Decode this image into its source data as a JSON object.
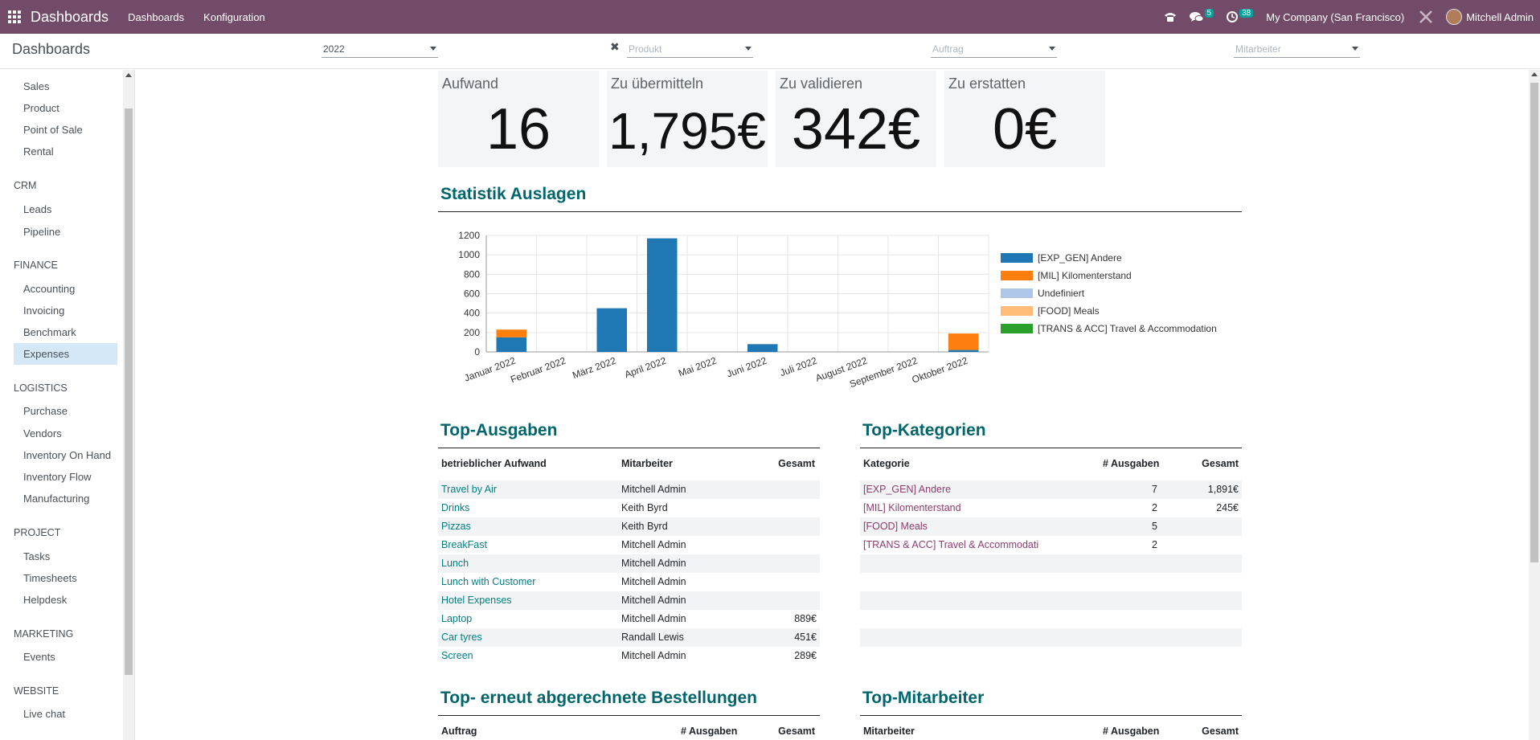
{
  "navbar": {
    "brand": "Dashboards",
    "menu": [
      "Dashboards",
      "Konfiguration"
    ],
    "messages_count": "5",
    "activities_count": "38",
    "company": "My Company (San Francisco)",
    "user": "Mitchell Admin"
  },
  "control": {
    "title": "Dashboards",
    "filters": [
      {
        "value": "2022",
        "placeholder": ""
      },
      {
        "value": "",
        "placeholder": "Produkt"
      },
      {
        "value": "",
        "placeholder": "Auftrag"
      },
      {
        "value": "",
        "placeholder": "Mitarbeiter"
      }
    ],
    "clear_icon": "✖"
  },
  "sidebar": {
    "sections": [
      {
        "header": "",
        "items": [
          "Sales",
          "Product",
          "Point of Sale",
          "Rental"
        ]
      },
      {
        "header": "CRM",
        "items": [
          "Leads",
          "Pipeline"
        ]
      },
      {
        "header": "FINANCE",
        "items": [
          "Accounting",
          "Invoicing",
          "Benchmark",
          "Expenses"
        ]
      },
      {
        "header": "LOGISTICS",
        "items": [
          "Purchase",
          "Vendors",
          "Inventory On Hand",
          "Inventory Flow",
          "Manufacturing"
        ]
      },
      {
        "header": "PROJECT",
        "items": [
          "Tasks",
          "Timesheets",
          "Helpdesk"
        ]
      },
      {
        "header": "MARKETING",
        "items": [
          "Events"
        ]
      },
      {
        "header": "WEBSITE",
        "items": [
          "Live chat"
        ]
      }
    ],
    "active": "Expenses"
  },
  "kpis": [
    {
      "label": "Aufwand",
      "value": "16"
    },
    {
      "label": "Zu übermitteln",
      "value": "1,795€"
    },
    {
      "label": "Zu validieren",
      "value": "342€"
    },
    {
      "label": "Zu erstatten",
      "value": "0€"
    }
  ],
  "sections": {
    "stats": "Statistik Auslagen",
    "top_expenses": "Top-Ausgaben",
    "top_categories": "Top-Kategorien",
    "top_reinvoiced": "Top- erneut abgerechnete Bestellungen",
    "top_employees": "Top-Mitarbeiter"
  },
  "chart_data": {
    "type": "bar",
    "stacked": true,
    "categories": [
      "Januar 2022",
      "Februar 2022",
      "März 2022",
      "April 2022",
      "Mai 2022",
      "Juni 2022",
      "Juli 2022",
      "August 2022",
      "September 2022",
      "Oktober 2022"
    ],
    "series": [
      {
        "name": "[EXP_GEN] Andere",
        "color": "#1f77b4",
        "values": [
          150,
          0,
          450,
          1170,
          0,
          80,
          0,
          0,
          0,
          20
        ]
      },
      {
        "name": "[MIL] Kilomenterstand",
        "color": "#ff7f0e",
        "values": [
          80,
          0,
          0,
          0,
          0,
          0,
          0,
          0,
          0,
          170
        ]
      },
      {
        "name": "Undefiniert",
        "color": "#aec7e8",
        "values": [
          0,
          0,
          0,
          0,
          0,
          0,
          0,
          0,
          0,
          0
        ]
      },
      {
        "name": "[FOOD] Meals",
        "color": "#ffbb78",
        "values": [
          0,
          0,
          0,
          0,
          0,
          0,
          0,
          0,
          0,
          0
        ]
      },
      {
        "name": "[TRANS & ACC] Travel & Accommodation",
        "color": "#2ca02c",
        "values": [
          0,
          0,
          0,
          0,
          0,
          0,
          0,
          0,
          0,
          0
        ]
      }
    ],
    "ylim": [
      0,
      1200
    ],
    "yticks": [
      0,
      200,
      400,
      600,
      800,
      1000,
      1200
    ],
    "grid": true,
    "legend_position": "right"
  },
  "top_expenses": {
    "headers": [
      "betrieblicher Aufwand",
      "Mitarbeiter",
      "Gesamt"
    ],
    "rows": [
      [
        "Travel by Air",
        "Mitchell Admin",
        ""
      ],
      [
        "Drinks",
        "Keith Byrd",
        ""
      ],
      [
        "Pizzas",
        "Keith Byrd",
        ""
      ],
      [
        "BreakFast",
        "Mitchell Admin",
        ""
      ],
      [
        "Lunch",
        "Mitchell Admin",
        ""
      ],
      [
        "Lunch with Customer",
        "Mitchell Admin",
        ""
      ],
      [
        "Hotel Expenses",
        "Mitchell Admin",
        ""
      ],
      [
        "Laptop",
        "Mitchell Admin",
        "889€"
      ],
      [
        "Car tyres",
        "Randall Lewis",
        "451€"
      ],
      [
        "Screen",
        "Mitchell Admin",
        "289€"
      ]
    ]
  },
  "top_categories": {
    "headers": [
      "Kategorie",
      "# Ausgaben",
      "Gesamt"
    ],
    "rows": [
      [
        "[EXP_GEN] Andere",
        "7",
        "1,891€"
      ],
      [
        "[MIL] Kilomenterstand",
        "2",
        "245€"
      ],
      [
        "[FOOD] Meals",
        "5",
        ""
      ],
      [
        "[TRANS & ACC] Travel & Accommodati",
        "2",
        ""
      ],
      [
        "",
        "",
        ""
      ],
      [
        "",
        "",
        ""
      ],
      [
        "",
        "",
        ""
      ],
      [
        "",
        "",
        ""
      ],
      [
        "",
        "",
        ""
      ],
      [
        "",
        "",
        ""
      ]
    ]
  },
  "top_reinvoiced": {
    "headers": [
      "Auftrag",
      "# Ausgaben",
      "Gesamt"
    ]
  },
  "top_employees": {
    "headers": [
      "Mitarbeiter",
      "# Ausgaben",
      "Gesamt"
    ]
  }
}
